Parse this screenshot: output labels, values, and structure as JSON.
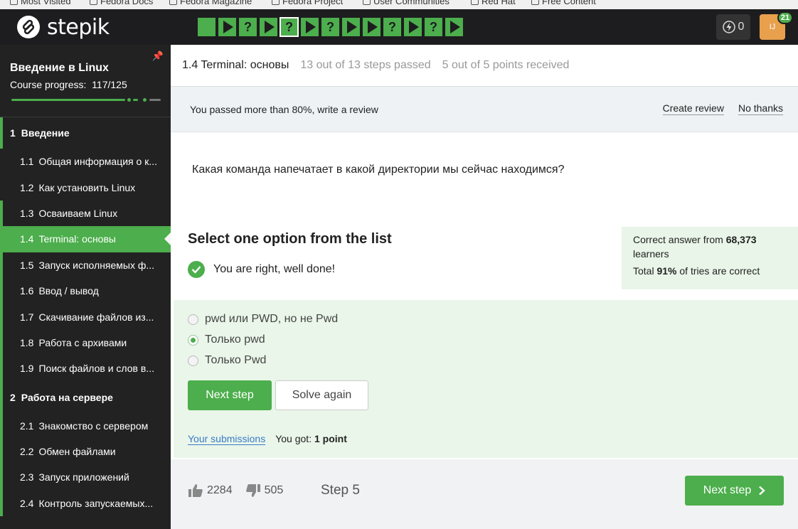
{
  "bookmarks": [
    "Most Visited",
    "Fedora Docs",
    "Fedora Magazine",
    "Fedora Project",
    "User Communities",
    "Red Hat",
    "Free Content"
  ],
  "header": {
    "logo_text": "stepik",
    "steps": [
      {
        "type": "square",
        "label": ""
      },
      {
        "type": "play",
        "label": ""
      },
      {
        "type": "quiz",
        "label": "?"
      },
      {
        "type": "play",
        "label": ""
      },
      {
        "type": "quiz",
        "label": "?",
        "current": true
      },
      {
        "type": "play",
        "label": ""
      },
      {
        "type": "quiz",
        "label": "?"
      },
      {
        "type": "play",
        "label": ""
      },
      {
        "type": "play",
        "label": ""
      },
      {
        "type": "quiz",
        "label": "?"
      },
      {
        "type": "play",
        "label": ""
      },
      {
        "type": "quiz",
        "label": "?"
      },
      {
        "type": "play",
        "label": ""
      }
    ],
    "energy_count": "0",
    "avatar_initials": "IJ",
    "notifications": "21"
  },
  "sidebar": {
    "course_title": "Введение в Linux",
    "progress_label": "Course progress:",
    "progress_value": "117/125",
    "progress_fraction": 0.936,
    "modules": [
      {
        "num": "1",
        "title": "Введение",
        "lessons": [
          {
            "num": "1.1",
            "title": "Общая информация о к...",
            "done": false
          },
          {
            "num": "1.2",
            "title": "Как установить Linux",
            "done": false
          },
          {
            "num": "1.3",
            "title": "Осваиваем Linux",
            "done": true
          },
          {
            "num": "1.4",
            "title": "Terminal: основы",
            "done": true,
            "active": true
          },
          {
            "num": "1.5",
            "title": "Запуск исполняемых ф...",
            "done": true
          },
          {
            "num": "1.6",
            "title": "Ввод / вывод",
            "done": true
          },
          {
            "num": "1.7",
            "title": "Скачивание файлов из...",
            "done": true
          },
          {
            "num": "1.8",
            "title": "Работа с архивами",
            "done": true
          },
          {
            "num": "1.9",
            "title": "Поиск файлов и слов в...",
            "done": true
          }
        ]
      },
      {
        "num": "2",
        "title": "Работа на сервере",
        "lessons": [
          {
            "num": "2.1",
            "title": "Знакомство с сервером",
            "done": true
          },
          {
            "num": "2.2",
            "title": "Обмен файлами",
            "done": true
          },
          {
            "num": "2.3",
            "title": "Запуск приложений",
            "done": true
          },
          {
            "num": "2.4",
            "title": "Контроль запускаемых...",
            "done": true
          }
        ]
      }
    ]
  },
  "lesson_header": {
    "title": "1.4 Terminal: основы",
    "steps_passed": "13 out of 13 steps passed",
    "points": "5 out of 5 points  received"
  },
  "review_banner": {
    "text": "You passed more than 80%, write a review",
    "create_label": "Create review",
    "decline_label": "No thanks"
  },
  "quiz": {
    "question": "Какая команда напечатает в какой директории мы сейчас находимся?",
    "select_title": "Select one option from the list",
    "result_text": "You are right, well done!",
    "stats_line1_prefix": "Correct answer from ",
    "stats_learners": "68,373",
    "stats_line1_suffix": "learners",
    "stats_line2_prefix": "Total ",
    "stats_percent": "91%",
    "stats_line2_suffix": " of tries are correct",
    "options": [
      {
        "label": "pwd или PWD, но не Pwd",
        "selected": false
      },
      {
        "label": "Только pwd",
        "selected": true
      },
      {
        "label": "Только Pwd",
        "selected": false
      }
    ],
    "next_button": "Next step",
    "solve_again_button": "Solve again",
    "submissions_link": "Your submissions",
    "got_prefix": "You got: ",
    "got_value": "1 point"
  },
  "footer": {
    "likes": "2284",
    "dislikes": "505",
    "step_label": "Step 5",
    "next_button": "Next step"
  },
  "colors": {
    "accent": "#4cae4c",
    "header_bg": "#1d1d1f",
    "sidebar_bg": "#222222"
  }
}
